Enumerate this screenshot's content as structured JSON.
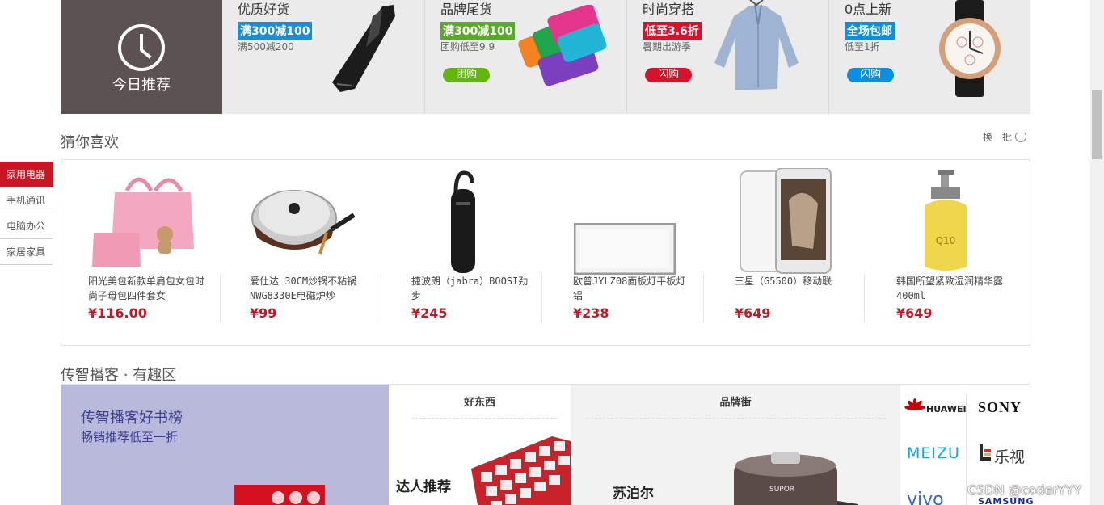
{
  "today": {
    "title": "今日推荐",
    "promos": [
      {
        "title": "优质好货",
        "tag": "满300减100",
        "tag_color": "#1a8cd8",
        "sub": "满500减200",
        "button": ""
      },
      {
        "title": "品牌尾货",
        "tag": "满300减100",
        "tag_color": "#5aaa2a",
        "sub": "团购低至9.9",
        "button": "团购",
        "button_color": "#62b70f"
      },
      {
        "title": "时尚穿搭",
        "tag": "低至3.6折",
        "tag_color": "#d9112a",
        "sub": "暑期出游季",
        "button": "闪购",
        "button_color": "#d9112a"
      },
      {
        "title": "0点上新",
        "tag": "全场包邮",
        "tag_color": "#0b8fe3",
        "sub": "低至1折",
        "button": "闪购",
        "button_color": "#0b8fe3"
      }
    ]
  },
  "sidenav": [
    "家用电器",
    "手机通讯",
    "电脑办公",
    "家居家具"
  ],
  "guess": {
    "title": "猜你喜欢",
    "refresh": "换一批",
    "items": [
      {
        "name": "阳光美包新款单肩包女包时尚子母包四件套女",
        "price": "¥116.00"
      },
      {
        "name": "爱仕达 30CM炒锅不粘锅NWG8330E电磁炉炒",
        "price": "¥99"
      },
      {
        "name": "捷波朗（jabra）BOOSI劲步",
        "price": "¥245"
      },
      {
        "name": "欧普JYLZ08面板灯平板灯铝",
        "price": "¥238"
      },
      {
        "name": "三星（G5500）移动联",
        "price": "¥649"
      },
      {
        "name": "韩国所望紧致湿润精华露400ml",
        "price": "¥649"
      }
    ]
  },
  "fun": {
    "title": "传智播客 · 有趣区",
    "book_title": "传智播客好书榜",
    "book_sub": "畅销推荐低至一折",
    "good_things": "好东西",
    "talent": "达人推荐",
    "brand_street": "品牌街",
    "brand_name": "苏泊尔",
    "brands": [
      "HUAWEI",
      "SONY",
      "MEIZU",
      "乐视",
      "vivo",
      "SAMSUNG"
    ]
  },
  "watermark": "CSDN @coderYYY"
}
